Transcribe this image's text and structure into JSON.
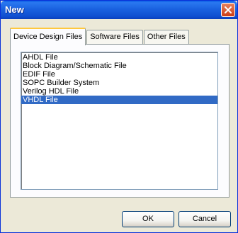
{
  "window": {
    "title": "New"
  },
  "tabs": [
    {
      "label": "Device Design Files",
      "active": true
    },
    {
      "label": "Software Files",
      "active": false
    },
    {
      "label": "Other Files",
      "active": false
    }
  ],
  "file_types": [
    {
      "label": "AHDL File",
      "selected": false
    },
    {
      "label": "Block Diagram/Schematic File",
      "selected": false
    },
    {
      "label": "EDIF File",
      "selected": false
    },
    {
      "label": "SOPC Builder System",
      "selected": false
    },
    {
      "label": "Verilog HDL File",
      "selected": false
    },
    {
      "label": "VHDL File",
      "selected": true
    }
  ],
  "buttons": {
    "ok_label": "OK",
    "cancel_label": "Cancel"
  },
  "colors": {
    "titlebar": "#0a5de5",
    "selection": "#316ac5",
    "dialog_bg": "#ece9d8",
    "close": "#cd3d16"
  }
}
